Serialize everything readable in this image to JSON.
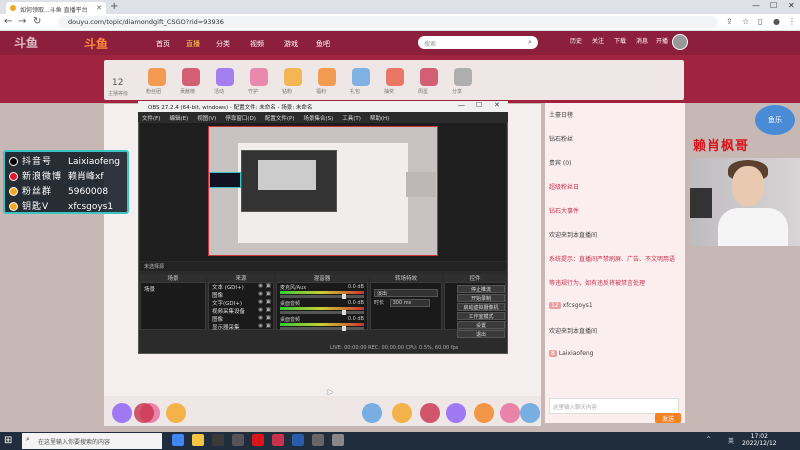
{
  "browser": {
    "tab_title": "如何领取...斗鱼 直播平台",
    "url": "douyu.com/topic/diamondgift_CSGO?rid=93936",
    "new_tab": "+",
    "win_controls": [
      "—",
      "☐",
      "✕"
    ]
  },
  "site": {
    "logo": "斗鱼",
    "nav": [
      "首页",
      "直播",
      "分类",
      "视频",
      "游戏",
      "鱼吧"
    ],
    "active_nav": "直播",
    "search_placeholder": "搜索",
    "header_icons": [
      "历史",
      "关注",
      "下载",
      "消息",
      "开播"
    ],
    "watermark": "斗鱼"
  },
  "room": {
    "level": "12",
    "level_caption": "主播等级",
    "bar_items": [
      "粉丝团",
      "贡献榜",
      "活动",
      "守护",
      "钻粉",
      "福利",
      "礼包",
      "抽奖",
      "周星",
      "分享"
    ]
  },
  "right_panel": {
    "rows": [
      {
        "tag": "",
        "text": "土豪日榜",
        "red": false
      },
      {
        "tag": "",
        "text": "钻石粉丝",
        "red": false
      },
      {
        "tag": "",
        "text": "贵宾 (0)",
        "red": false
      },
      {
        "tag": "",
        "text": "超级粉丝日",
        "red": true
      },
      {
        "tag": "",
        "text": "钻石大事件",
        "red": true
      },
      {
        "tag": "",
        "text": "欢迎来到本直播间",
        "red": false
      },
      {
        "tag": "",
        "text": "系统提示：直播间严禁刷屏、广告、不文明用语",
        "red": true
      },
      {
        "tag": "",
        "text": "等违规行为，如有违反将被禁言处理",
        "red": true
      },
      {
        "tag": "12",
        "text": "xfcsgoys1",
        "red": false
      },
      {
        "tag": "",
        "text": "欢迎来到本直播间",
        "red": false
      },
      {
        "tag": "8",
        "text": "Laixiaofeng",
        "red": false
      }
    ],
    "chat_placeholder": "这里输入聊天内容",
    "send_label": "发送"
  },
  "overlay": {
    "banner": "赖肖枫哥",
    "corner_logo": "鱼乐"
  },
  "info_card": {
    "rows": [
      {
        "label": "抖音号",
        "value": "Laixiaofeng",
        "icon_color": "#000000"
      },
      {
        "label": "新浪微博",
        "value": "赖肖峰xf",
        "icon_color": "#e6162d"
      },
      {
        "label": "粉丝群",
        "value": "5960008",
        "icon_color": "#f5a623"
      },
      {
        "label": "钥匙V",
        "value": "xfcsgoys1",
        "icon_color": "#f5a623"
      }
    ]
  },
  "obs": {
    "title": "OBS 27.2.4 (64-bit, windows) - 配置文件: 未命名 - 场景: 未命名",
    "menu": [
      "文件(F)",
      "编辑(E)",
      "视图(V)",
      "停靠窗口(D)",
      "配置文件(P)",
      "场景集合(S)",
      "工具(T)",
      "帮助(H)"
    ],
    "preview_bar": "未选择源",
    "panels": {
      "scenes": "场景",
      "sources": "来源",
      "mixer": "混音器",
      "transitions": "转场特效",
      "controls": "控件"
    },
    "scene_items": [
      "场景"
    ],
    "source_items": [
      "文本 (GDI+)",
      "图像",
      "文字(GDI+)",
      "视频采集设备",
      "图像",
      "显示器采集"
    ],
    "mixer_items": [
      {
        "name": "麦克风/Aux",
        "db": "0.0 dB"
      },
      {
        "name": "桌面音频",
        "db": "0.0 dB"
      },
      {
        "name": "桌面音频",
        "db": "0.0 dB"
      }
    ],
    "transition": {
      "type": "淡出",
      "duration_label": "时长",
      "duration": "300 ms"
    },
    "controls": [
      "停止推流",
      "开始录制",
      "启动虚拟摄像机",
      "工作室模式",
      "设置",
      "退出"
    ],
    "status": "LIVE: 00:00:00   REC: 00:00:00   CPU: 0.5%, 60.00 fps"
  },
  "taskbar": {
    "search_placeholder": "在这里输入你要搜索的内容",
    "time": "17:02",
    "date": "2022/12/12",
    "tray": [
      "^",
      "英"
    ]
  }
}
